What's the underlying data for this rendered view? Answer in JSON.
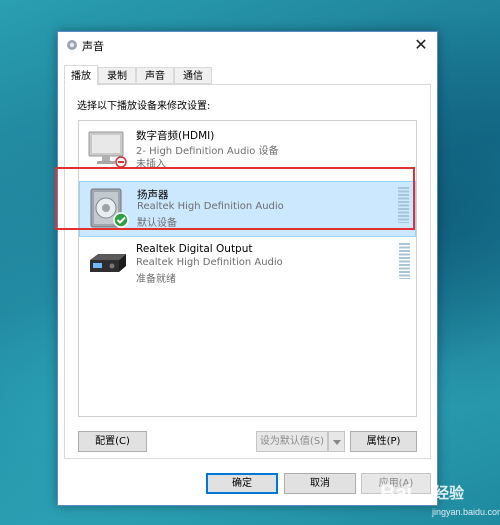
{
  "window": {
    "title": "声音"
  },
  "tabs": [
    {
      "label": "播放",
      "active": true
    },
    {
      "label": "录制",
      "active": false
    },
    {
      "label": "声音",
      "active": false
    },
    {
      "label": "通信",
      "active": false
    }
  ],
  "instruction": "选择以下播放设备来修改设置:",
  "devices": [
    {
      "name": "数字音频(HDMI)",
      "line2": "2- High Definition Audio 设备",
      "status": "未插入",
      "icon": "monitor-icon",
      "badge": "unplugged-badge"
    },
    {
      "name": "扬声器",
      "line2": "Realtek High Definition Audio",
      "status": "默认设备",
      "icon": "speaker-icon",
      "badge": "default-check-badge",
      "selected": true
    },
    {
      "name": "Realtek Digital Output",
      "line2": "Realtek High Definition Audio",
      "status": "准备就绪",
      "icon": "digital-output-icon"
    }
  ],
  "buttons": {
    "configure": "配置(C)",
    "set_default": "设为默认值(S)",
    "properties": "属性(P)",
    "ok": "确定",
    "cancel": "取消",
    "apply": "应用(A)"
  },
  "watermark": {
    "logo": "Bai",
    "text": "经验",
    "url": "jingyan.baidu.com"
  },
  "colors": {
    "selection": "#cce8ff",
    "highlight_box": "#e03030",
    "accent": "#0078d7"
  }
}
